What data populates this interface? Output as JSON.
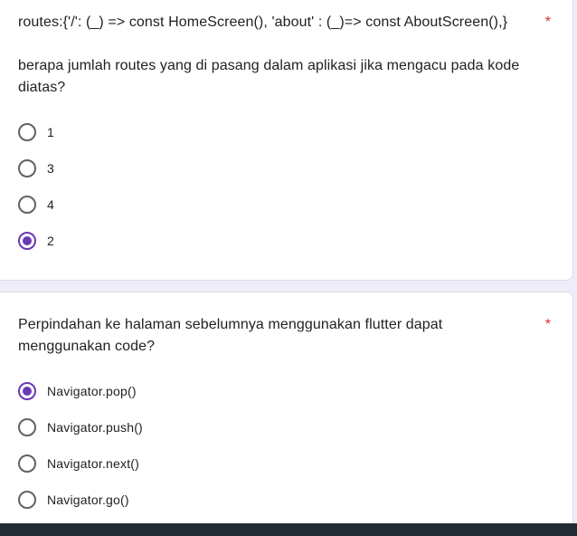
{
  "question1": {
    "code_line": "routes:{'/': (_) => const HomeScreen(), 'about' : (_)=> const AboutScreen(),}",
    "text": "berapa jumlah routes yang di pasang dalam aplikasi jika mengacu pada kode diatas?",
    "required_mark": "*",
    "options": [
      {
        "label": "1",
        "checked": false
      },
      {
        "label": "3",
        "checked": false
      },
      {
        "label": "4",
        "checked": false
      },
      {
        "label": "2",
        "checked": true
      }
    ]
  },
  "question2": {
    "text": "Perpindahan ke halaman sebelumnya menggunakan flutter dapat menggunakan code?",
    "required_mark": "*",
    "options": [
      {
        "label": "Navigator.pop()",
        "checked": true
      },
      {
        "label": "Navigator.push()",
        "checked": false
      },
      {
        "label": "Navigator.next()",
        "checked": false
      },
      {
        "label": "Navigator.go()",
        "checked": false
      }
    ]
  },
  "colors": {
    "accent": "#673ab7",
    "required": "#d93025",
    "text": "#202124",
    "radio_unchecked": "#5f6368"
  }
}
